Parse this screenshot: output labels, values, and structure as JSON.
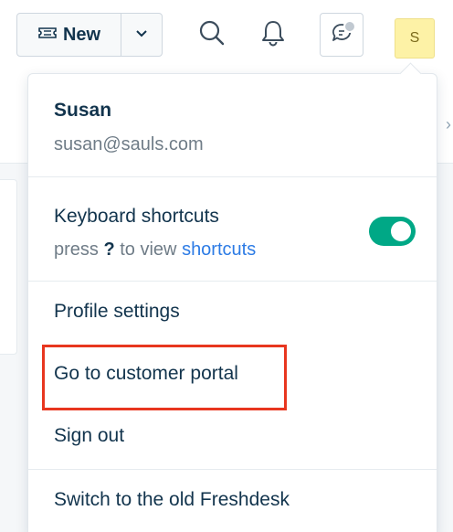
{
  "topbar": {
    "new_label": "New",
    "new_icon": "ticket-icon",
    "dropdown_icon": "chevron-down-icon",
    "search_icon": "search-icon",
    "notifications_icon": "bell-icon",
    "chat_icon": "chat-icon",
    "avatar_initial": "S"
  },
  "menu": {
    "user_name": "Susan",
    "user_email": "susan@sauls.com",
    "keyboard_shortcuts": {
      "title": "Keyboard shortcuts",
      "press": "press",
      "key": "?",
      "to_view": "to view",
      "link": "shortcuts",
      "enabled": true
    },
    "items": [
      {
        "label": "Profile settings"
      },
      {
        "label": "Go to customer portal"
      },
      {
        "label": "Sign out"
      },
      {
        "label": "Switch to the old Freshdesk"
      }
    ]
  },
  "colors": {
    "accent": "#2c7be5",
    "toggle_on": "#00a886",
    "highlight": "#e8361f",
    "avatar_bg": "#fdf2a6",
    "text": "#12344d",
    "muted": "#6f7c87"
  }
}
